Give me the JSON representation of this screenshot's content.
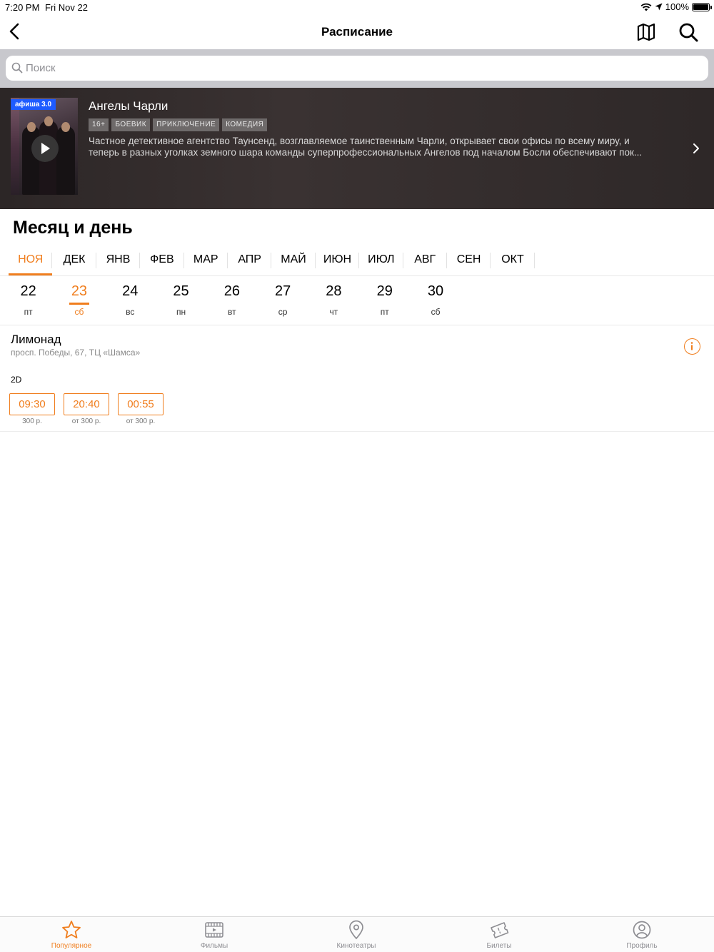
{
  "status_bar": {
    "time": "7:20 PM",
    "date": "Fri Nov 22",
    "battery": "100%"
  },
  "nav": {
    "title": "Расписание"
  },
  "search": {
    "placeholder": "Поиск",
    "value": ""
  },
  "movie": {
    "poster_label": "афиша 3.0",
    "title": "Ангелы Чарли",
    "tags": [
      "16+",
      "БОЕВИК",
      "ПРИКЛЮЧЕНИЕ",
      "КОМЕДИЯ"
    ],
    "description_line1": "Частное детективное агентство Таунсенд, возглавляемое таинственным Чарли, открывает свои офисы по всему миру, и",
    "description_line2": "теперь в разных уголках земного шара команды суперпрофессиональных Ангелов под началом Босли обеспечивают пок..."
  },
  "section_title": "Месяц и день",
  "months": [
    "НОЯ",
    "ДЕК",
    "ЯНВ",
    "ФЕВ",
    "МАР",
    "АПР",
    "МАЙ",
    "ИЮН",
    "ИЮЛ",
    "АВГ",
    "СЕН",
    "ОКТ"
  ],
  "active_month": "НОЯ",
  "days": [
    {
      "num": "22",
      "name": "пт"
    },
    {
      "num": "23",
      "name": "сб"
    },
    {
      "num": "24",
      "name": "вс"
    },
    {
      "num": "25",
      "name": "пн"
    },
    {
      "num": "26",
      "name": "вт"
    },
    {
      "num": "27",
      "name": "ср"
    },
    {
      "num": "28",
      "name": "чт"
    },
    {
      "num": "29",
      "name": "пт"
    },
    {
      "num": "30",
      "name": "сб"
    }
  ],
  "active_day": "23",
  "cinema": {
    "name": "Лимонад",
    "address": "просп. Победы, 67, ТЦ «Шамса»",
    "format": "2D",
    "sessions": [
      {
        "time": "09:30",
        "price": "300 р."
      },
      {
        "time": "20:40",
        "price": "от 300 р."
      },
      {
        "time": "00:55",
        "price": "от 300 р."
      }
    ]
  },
  "tab_bar": {
    "items": [
      {
        "label": "Популярное",
        "icon": "star-icon",
        "active": true
      },
      {
        "label": "Фильмы",
        "icon": "film-icon",
        "active": false
      },
      {
        "label": "Кинотеатры",
        "icon": "location-pin-icon",
        "active": false
      },
      {
        "label": "Билеты",
        "icon": "tickets-icon",
        "active": false
      },
      {
        "label": "Профиль",
        "icon": "profile-icon",
        "active": false
      }
    ]
  },
  "colors": {
    "accent": "#f07e1e",
    "banner_bg": "#2c2626",
    "search_bg": "#c8c8cd"
  }
}
